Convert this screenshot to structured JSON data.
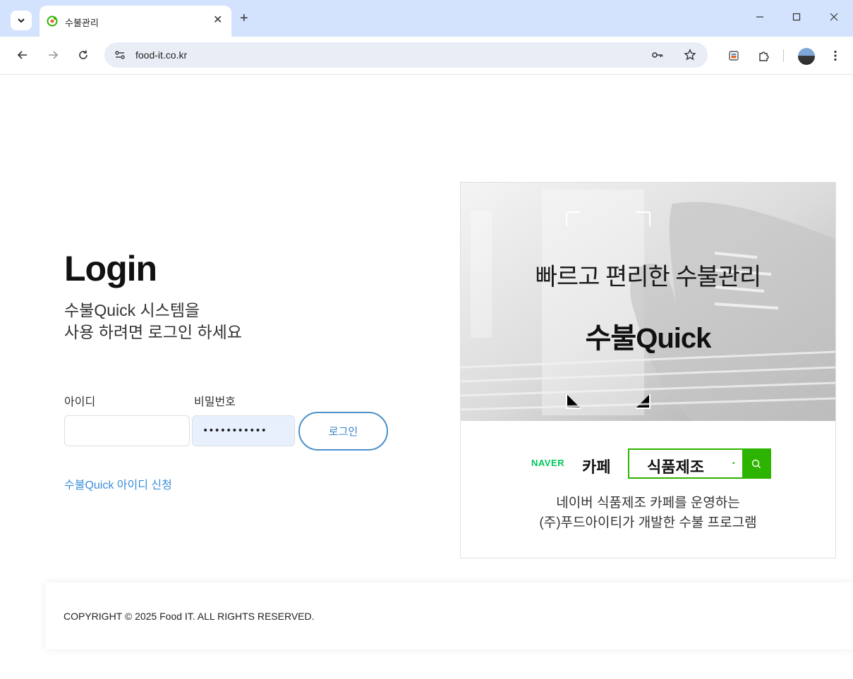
{
  "browser": {
    "tab_title": "수불관리",
    "url": "food-it.co.kr"
  },
  "login": {
    "title": "Login",
    "subtitle_line1": "수불Quick 시스템을",
    "subtitle_line2": "사용 하려면 로그인 하세요",
    "id_label": "아이디",
    "id_value": "",
    "password_label": "비밀번호",
    "password_value": "•••••••••••",
    "login_button": "로그인",
    "signup_link": "수불Quick 아이디 신청"
  },
  "promo": {
    "headline": "빠르고 편리한 수불관리",
    "brand": "수불Quick",
    "naver_logo": "NAVER",
    "cafe_label": "카페",
    "search_text": "식품제조",
    "desc_line1": "네이버 식품제조 카페를  운영하는",
    "desc_line2": "(주)푸드아이티가 개발한 수불 프로그램"
  },
  "footer": {
    "copyright": "COPYRIGHT © 2025 Food IT. ALL RIGHTS RESERVED."
  },
  "colors": {
    "tabstrip": "#d3e3fd",
    "accent_blue": "#3a8fd8",
    "naver_green": "#2db400"
  }
}
